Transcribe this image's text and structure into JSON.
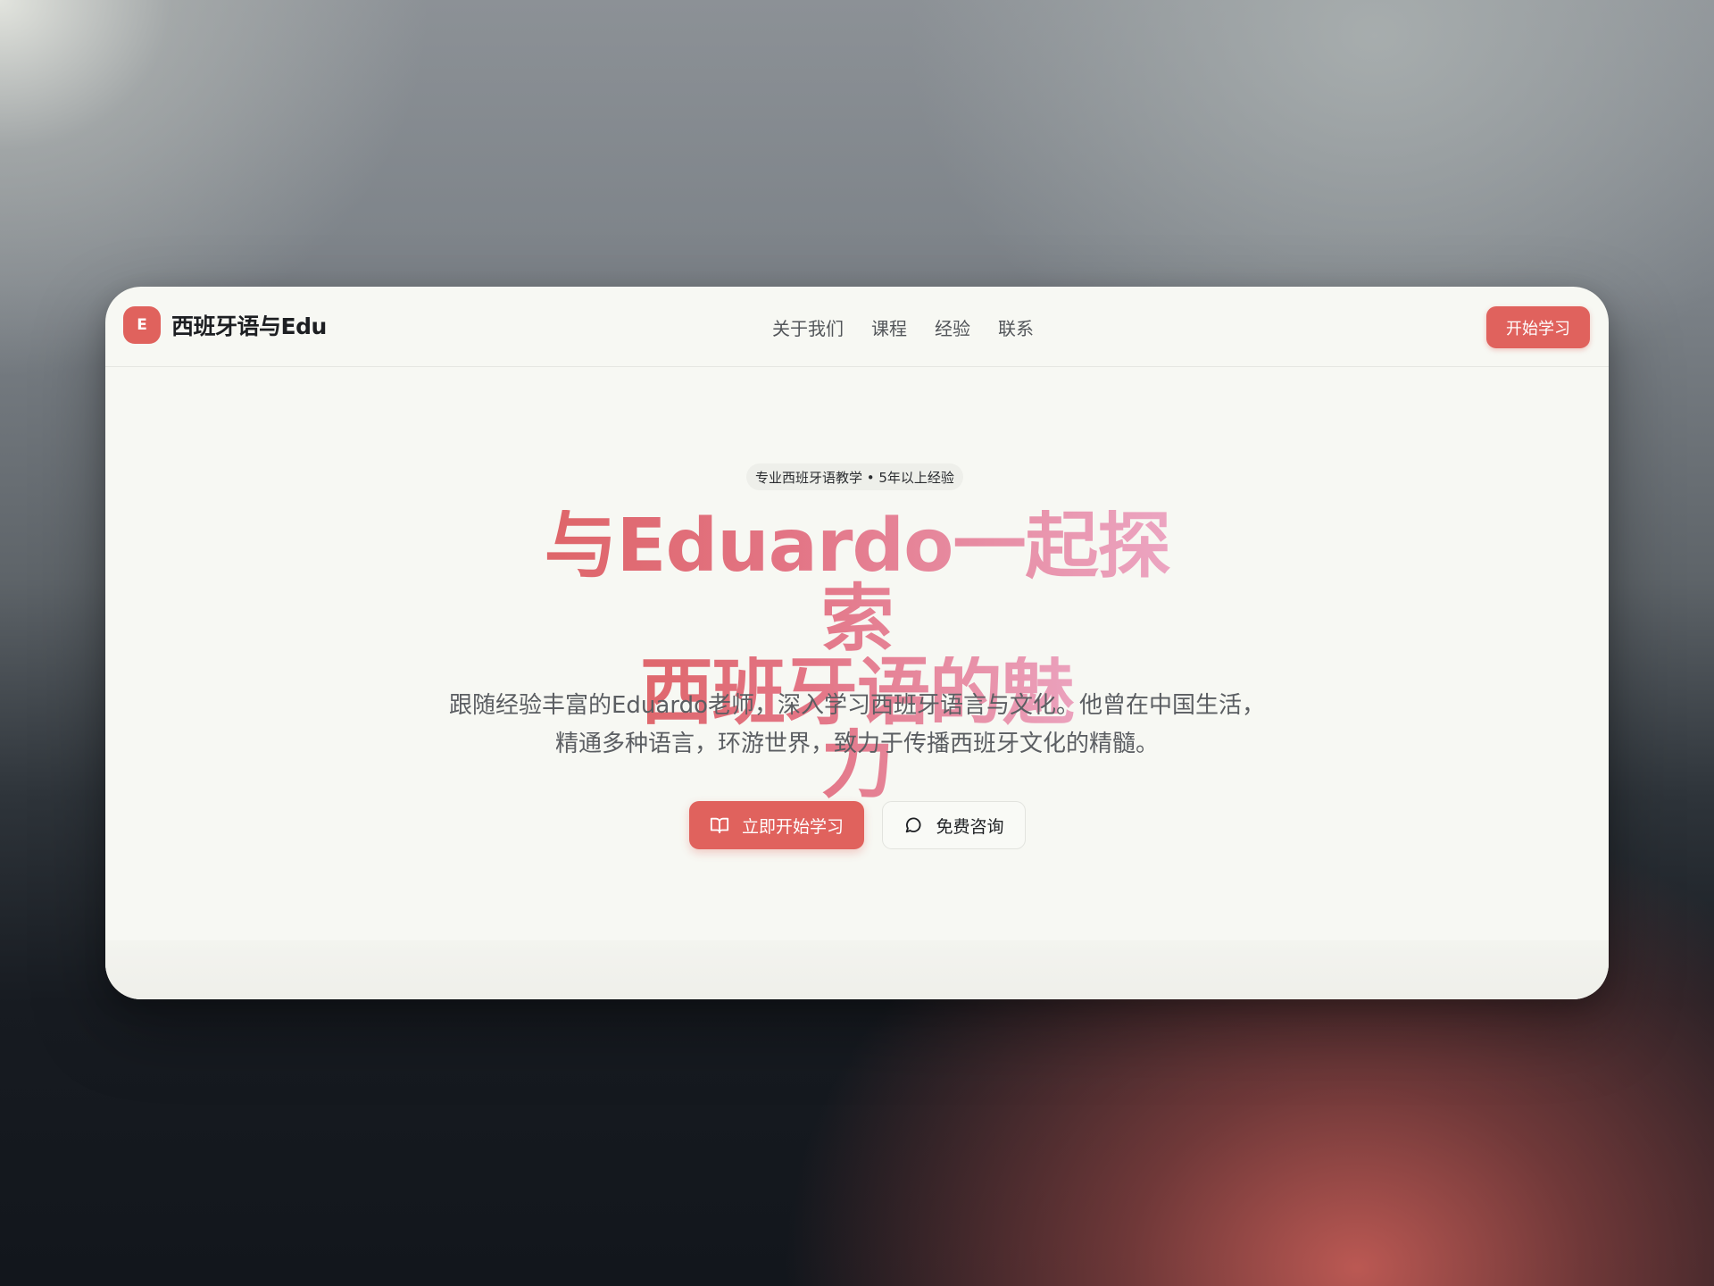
{
  "header": {
    "logo_letter": "E",
    "brand": "西班牙语与Edu",
    "nav": [
      "关于我们",
      "课程",
      "经验",
      "联系"
    ],
    "cta": "开始学习"
  },
  "hero": {
    "badge": "专业西班牙语教学 • 5年以上经验",
    "headline_line1": "与Eduardo一起探索",
    "headline_line2": "西班牙语的魅力",
    "subtitle": "跟随经验丰富的Eduardo老师，深入学习西班牙语言与文化。他曾在中国生活，精通多种语言，环游世界，致力于传播西班牙文化的精髓。",
    "primary_button": "立即开始学习",
    "primary_icon": "book-open-icon",
    "secondary_button": "免费咨询",
    "secondary_icon": "chat-bubble-icon"
  },
  "colors": {
    "accent": "#e0625d",
    "headline_gradient_start": "#de6467",
    "headline_gradient_end": "#eca7c4",
    "card_background": "#f7f8f3"
  }
}
